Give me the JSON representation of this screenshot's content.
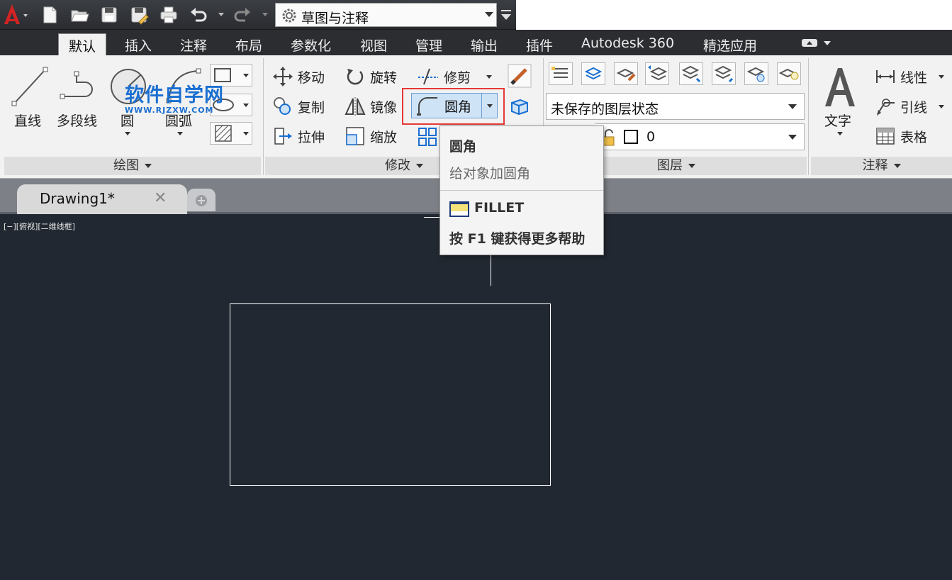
{
  "qat": {
    "workspace": "草图与注释"
  },
  "tabs": [
    "默认",
    "插入",
    "注释",
    "布局",
    "参数化",
    "视图",
    "管理",
    "输出",
    "插件",
    "Autodesk 360",
    "精选应用"
  ],
  "watermark": {
    "title": "软件自学网",
    "url": "WWW.RJZXW.COM"
  },
  "draw": {
    "line": "直线",
    "polyline": "多段线",
    "circle": "圆",
    "arc": "圆弧",
    "group": "绘图"
  },
  "modify": {
    "move": "移动",
    "rotate": "旋转",
    "trim": "修剪",
    "copy": "复制",
    "mirror": "镜像",
    "fillet": "圆角",
    "stretch": "拉伸",
    "scale": "缩放",
    "group": "修改"
  },
  "layers": {
    "state": "未保存的图层状态",
    "current": "0",
    "group": "图层"
  },
  "annotation": {
    "text": "文字",
    "linear": "线性",
    "leader": "引线",
    "table": "表格",
    "group": "注释"
  },
  "document": {
    "tab": "Drawing1*",
    "viewport": "[−][俯视][二维线框]"
  },
  "tooltip": {
    "title": "圆角",
    "desc": "给对象加圆角",
    "command": "FILLET",
    "help": "按 F1 键获得更多帮助"
  },
  "colors": {
    "highlight": "#e53935",
    "canvas": "#222831",
    "watermark": "#1a6fd1"
  }
}
